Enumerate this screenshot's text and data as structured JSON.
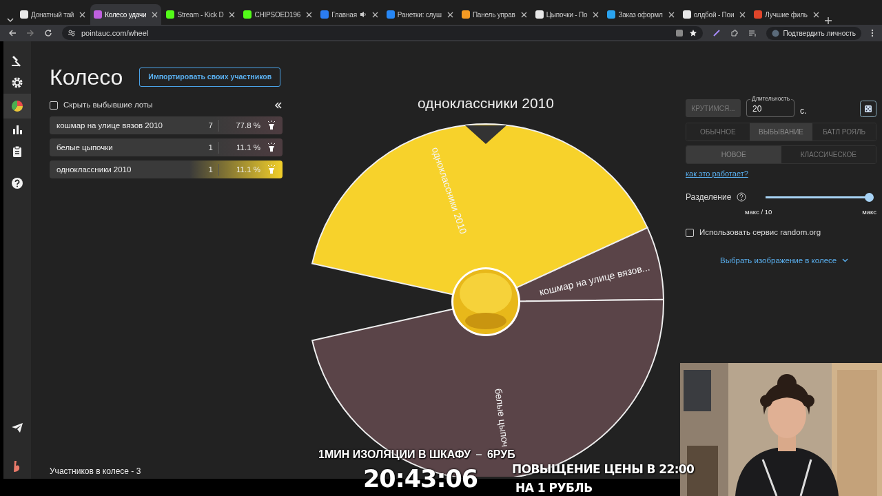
{
  "browser": {
    "tabs": [
      {
        "title": "Донатный тай",
        "color": "#e8e8e8",
        "audio": false,
        "selected": false
      },
      {
        "title": "Колесо удачи",
        "color": "#c060e0",
        "audio": false,
        "selected": true
      },
      {
        "title": "Stream - Kick D",
        "color": "#53fc18",
        "audio": false,
        "selected": false
      },
      {
        "title": "CHIPSOED196",
        "color": "#53fc18",
        "audio": false,
        "selected": false
      },
      {
        "title": "Главная",
        "color": "#2b7cf0",
        "audio": true,
        "selected": false
      },
      {
        "title": "Ранетки: слуш",
        "color": "#2787f5",
        "audio": false,
        "selected": false
      },
      {
        "title": "Панель управ",
        "color": "#f59a23",
        "audio": false,
        "selected": false
      },
      {
        "title": "Цыпочки - По",
        "color": "#e8e8e8",
        "audio": false,
        "selected": false
      },
      {
        "title": "Заказ оформл",
        "color": "#2aa3ef",
        "audio": false,
        "selected": false
      },
      {
        "title": "олдбой - Пои",
        "color": "#e8e8e8",
        "audio": false,
        "selected": false
      },
      {
        "title": "Лучшие филь",
        "color": "#e0452a",
        "audio": false,
        "selected": false
      }
    ],
    "url": "pointauc.com/wheel",
    "profile_button": "Подтвердить личность"
  },
  "sidebar": {
    "items": [
      {
        "kind": "gavel",
        "selected": false
      },
      {
        "kind": "gear",
        "selected": false
      },
      {
        "kind": "pie",
        "selected": true
      },
      {
        "kind": "bars",
        "selected": false
      },
      {
        "kind": "clipboard",
        "selected": false
      },
      {
        "kind": "help",
        "selected": false
      }
    ],
    "bottom_items": [
      {
        "kind": "plane"
      },
      {
        "kind": "logo"
      }
    ]
  },
  "page": {
    "title": "Колесо",
    "import_button": "Импортировать своих участников",
    "hide_eliminated": {
      "label": "Скрыть выбывшие лоты",
      "checked": false
    },
    "lots": [
      {
        "name": "кошмар на улице вязов 2010",
        "amount": "7",
        "percent": "77.8 %",
        "selected": false
      },
      {
        "name": "белые цыпочки",
        "amount": "1",
        "percent": "11.1 %",
        "selected": false
      },
      {
        "name": "одноклассники 2010",
        "amount": "1",
        "percent": "11.1 %",
        "selected": true
      }
    ],
    "participants_count": "Участников в колесе - 3"
  },
  "wheel": {
    "winner": "одноклассники 2010",
    "slices": [
      {
        "label": "одноклассники 2010",
        "color": "#f7d22b"
      },
      {
        "label": "кошмар на улице вязов...",
        "color": "#5a4448"
      },
      {
        "label": "белые цыпоч",
        "color": "#5a4448"
      }
    ]
  },
  "controls": {
    "spin_button": {
      "label": "КРУТИМСЯ...",
      "disabled": true
    },
    "duration": {
      "label": "Длительность",
      "value": "20",
      "unit": "с."
    },
    "modes": [
      {
        "label": "ОБЫЧНОЕ",
        "selected": false
      },
      {
        "label": "ВЫБЫВАНИЕ",
        "selected": true
      },
      {
        "label": "БАТЛ РОЯЛЬ",
        "selected": false
      }
    ],
    "variants": [
      {
        "label": "НОВОЕ",
        "selected": true
      },
      {
        "label": "КЛАССИЧЕСКОЕ",
        "selected": false
      }
    ],
    "help_link": "как это работает?",
    "split": {
      "label": "Разделение",
      "level": 1,
      "min_label": "макс / 10",
      "max_label": "макс"
    },
    "random_org": {
      "label": "Использовать сервис random.org",
      "checked": false
    },
    "image_picker": "Выбрать изображение в колесе"
  },
  "stream_overlay": {
    "offer": "1МИН ИЗОЛЯЦИИ В ШКАФУ",
    "price": "6РУБ",
    "clock": "20:43:06",
    "notice": [
      "ПОВЫЩЕНИЕ ЦЕНЫ В 22:00",
      "НА 1 РУБЛЬ"
    ],
    "webcam": {
      "kind": "picture"
    }
  }
}
